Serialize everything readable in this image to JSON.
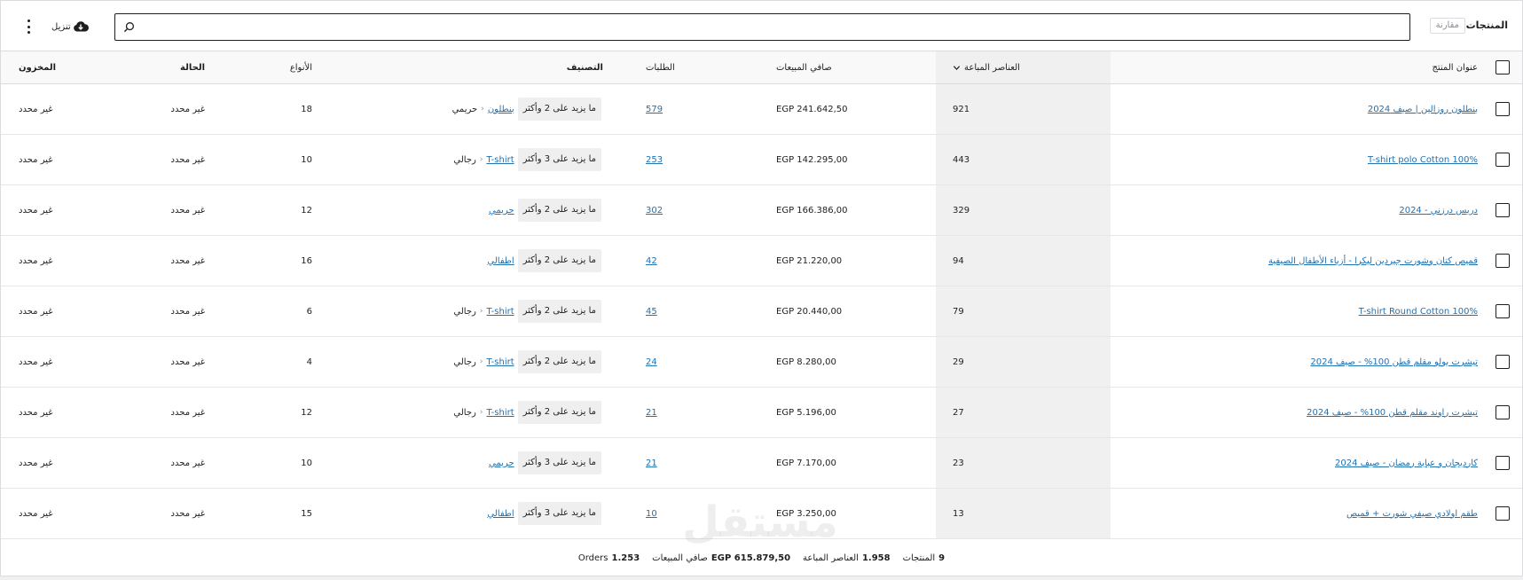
{
  "header": {
    "title": "المنتجات",
    "compare_label": "مقارنة",
    "search_placeholder": "",
    "download_label": "تنزيل"
  },
  "table": {
    "columns": {
      "name": "عنوان المنتج",
      "items_sold": "العناصر المباعة",
      "net_sales": "صافي المبيعات",
      "orders": "الطلبات",
      "category": "التصنيف",
      "variations": "الأنواع",
      "status": "الحالة",
      "stock": "المخزون"
    },
    "rows": [
      {
        "name": "بنطلون روزالين | صيف 2024",
        "items": "921",
        "sales": "EGP 241.642,50",
        "orders": "579",
        "cat_main": "حريمي",
        "cat_link": "بنطلون",
        "cat_more": "ما يزيد على 2 وأكثر",
        "variations": "18",
        "status": "غير محدد",
        "stock": "غير محدد"
      },
      {
        "name": "T-shirt polo Cotton 100%",
        "items": "443",
        "sales": "EGP 142.295,00",
        "orders": "253",
        "cat_main": "رجالي",
        "cat_link": "T-shirt",
        "cat_more": "ما يزيد على 3 وأكثر",
        "variations": "10",
        "status": "غير محدد",
        "stock": "غير محدد"
      },
      {
        "name": "دريس درزني - 2024",
        "items": "329",
        "sales": "EGP 166.386,00",
        "orders": "302",
        "cat_main": "",
        "cat_link": "حريمي",
        "cat_more": "ما يزيد على 2 وأكثر",
        "variations": "12",
        "status": "غير محدد",
        "stock": "غير محدد"
      },
      {
        "name": "قميص كتان وشورت جيردين ليكرا - أزياء الأطفال الصيفية",
        "items": "94",
        "sales": "EGP 21.220,00",
        "orders": "42",
        "cat_main": "",
        "cat_link": "اطفالي",
        "cat_more": "ما يزيد على 2 وأكثر",
        "variations": "16",
        "status": "غير محدد",
        "stock": "غير محدد"
      },
      {
        "name": "T-shirt Round Cotton 100%",
        "items": "79",
        "sales": "EGP 20.440,00",
        "orders": "45",
        "cat_main": "رجالي",
        "cat_link": "T-shirt",
        "cat_more": "ما يزيد على 2 وأكثر",
        "variations": "6",
        "status": "غير محدد",
        "stock": "غير محدد"
      },
      {
        "name": "تيشرت بولو مقلم قطن 100% - صيف 2024",
        "items": "29",
        "sales": "EGP 8.280,00",
        "orders": "24",
        "cat_main": "رجالي",
        "cat_link": "T-shirt",
        "cat_more": "ما يزيد على 2 وأكثر",
        "variations": "4",
        "status": "غير محدد",
        "stock": "غير محدد"
      },
      {
        "name": "تيشرت راوند مقلم قطن 100% - صيف 2024",
        "items": "27",
        "sales": "EGP 5.196,00",
        "orders": "21",
        "cat_main": "رجالي",
        "cat_link": "T-shirt",
        "cat_more": "ما يزيد على 2 وأكثر",
        "variations": "12",
        "status": "غير محدد",
        "stock": "غير محدد"
      },
      {
        "name": "كارديجان و عباية رمضان - صيف 2024",
        "items": "23",
        "sales": "EGP 7.170,00",
        "orders": "21",
        "cat_main": "",
        "cat_link": "حريمي",
        "cat_more": "ما يزيد على 3 وأكثر",
        "variations": "10",
        "status": "غير محدد",
        "stock": "غير محدد"
      },
      {
        "name": "طقم اولادي صيفي شورت + قميص",
        "items": "13",
        "sales": "EGP 3.250,00",
        "orders": "10",
        "cat_main": "",
        "cat_link": "اطفالي",
        "cat_more": "ما يزيد على 3 وأكثر",
        "variations": "15",
        "status": "غير محدد",
        "stock": "غير محدد"
      }
    ]
  },
  "footer": {
    "products_value": "9",
    "products_label": "المنتجات",
    "items_value": "1.958",
    "items_label": "العناصر المباعة",
    "sales_value": "EGP 615.879,50",
    "sales_label": "صافي المبيعات",
    "orders_value": "1.253",
    "orders_label": "Orders"
  },
  "watermark": "مستقل",
  "icons": {
    "search": "search-icon",
    "download": "cloud-download-icon",
    "menu": "more-vertical-icon",
    "sort": "chevron-down-icon"
  }
}
